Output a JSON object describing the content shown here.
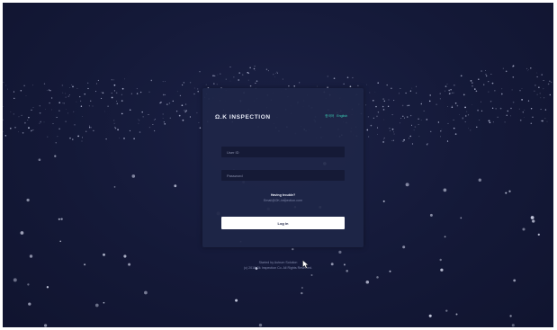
{
  "brand": {
    "name": "Ω.K INSPECTION",
    "icon": "brand-logo-icon"
  },
  "language": {
    "options": [
      "한국어",
      "English"
    ]
  },
  "form": {
    "user_id_placeholder": "User ID",
    "password_placeholder": "Password"
  },
  "help": {
    "title": "Having trouble?",
    "email": "Email@OK-inspection.com"
  },
  "login_button": "Log in",
  "footer": {
    "line1": "Started by Autrum Solution",
    "line2": "(c) 2018 Ok Inspection Co. All Rights Reserved."
  },
  "colors": {
    "background": "#141938",
    "card": "#1e2648",
    "accent": "#3ad1b5",
    "button": "#ffffff"
  }
}
